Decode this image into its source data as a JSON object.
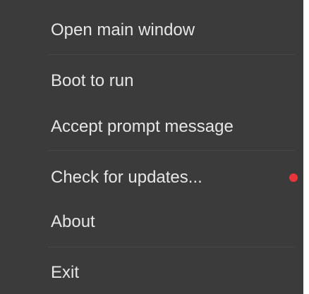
{
  "menu": {
    "items": [
      {
        "label": "Open main window"
      },
      {
        "label": "Boot to run"
      },
      {
        "label": "Accept prompt message"
      },
      {
        "label": "Check for updates..."
      },
      {
        "label": "About"
      },
      {
        "label": "Exit"
      }
    ],
    "update_indicator_color": "#e8343a"
  }
}
